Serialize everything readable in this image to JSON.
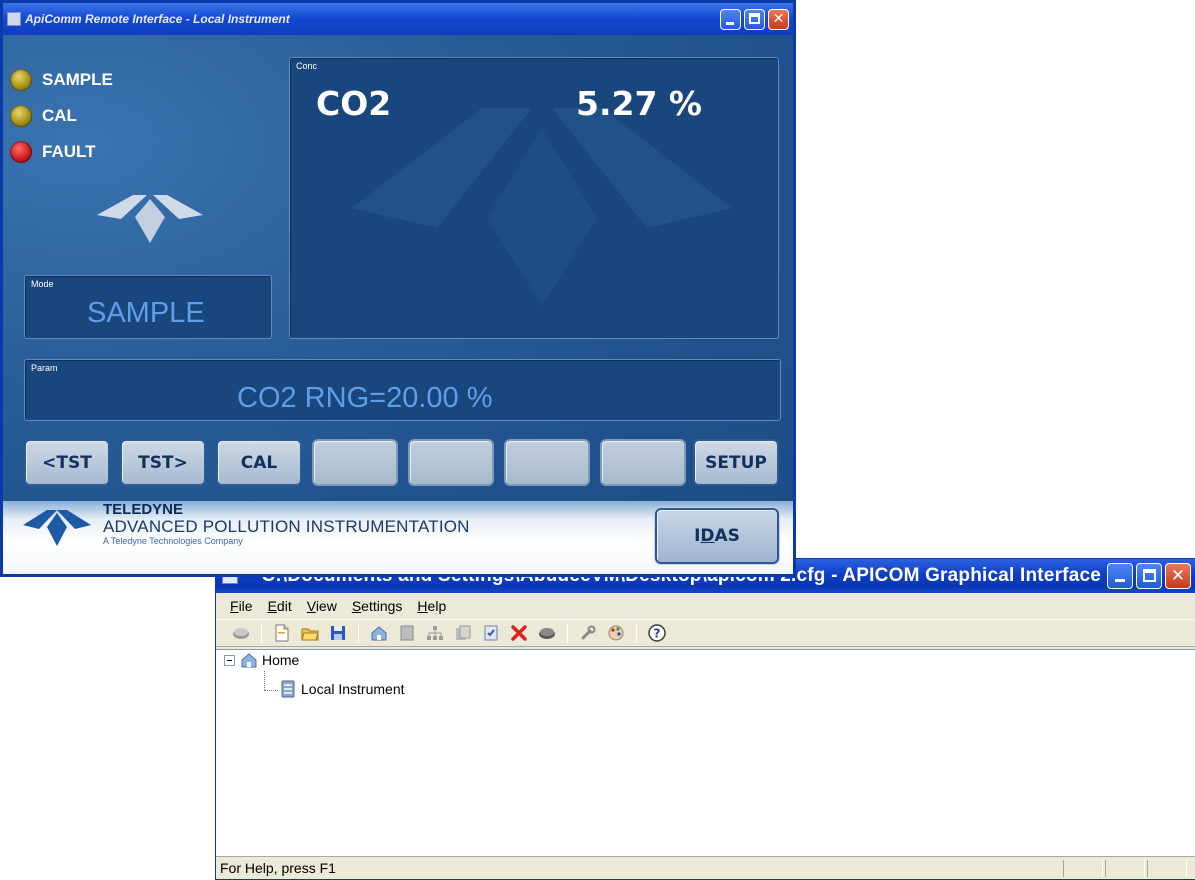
{
  "remote_window": {
    "title": "ApiComm Remote Interface - Local Instrument",
    "status_leds": [
      {
        "label": "SAMPLE",
        "color": "#c8b22a"
      },
      {
        "label": "CAL",
        "color": "#c8b22a"
      },
      {
        "label": "FAULT",
        "color": "#d02020"
      }
    ],
    "conc_panel": {
      "label": "Conc",
      "gas": "CO2",
      "value": "5.27 %"
    },
    "mode_panel": {
      "label": "Mode",
      "value": "SAMPLE"
    },
    "param_panel": {
      "label": "Param",
      "value": "CO2 RNG=20.00 %"
    },
    "keys": [
      "<TST",
      "TST>",
      "CAL",
      "",
      "",
      "",
      "",
      "SETUP"
    ],
    "brand": {
      "name": "TELEDYNE",
      "subtitle": "ADVANCED POLLUTION INSTRUMENTATION",
      "tagline": "A Teledyne Technologies Company"
    },
    "idas_button": {
      "prefix": "I",
      "underlined": "D",
      "suffix": "AS"
    }
  },
  "apicom_window": {
    "title": "C:\\Documents and Settings\\AbudeeVM\\Desktop\\apicom 2.cfg - APICOM Graphical Interface",
    "menu": [
      "File",
      "Edit",
      "View",
      "Settings",
      "Help"
    ],
    "toolbar_icons": [
      "connect-icon",
      "new-file-icon",
      "open-folder-icon",
      "save-disk-icon",
      "home-icon",
      "instrument-icon",
      "network-icon",
      "copy-icon",
      "properties-icon",
      "delete-icon",
      "disconnect-icon",
      "wrench-icon",
      "palette-icon",
      "help-icon"
    ],
    "tree": {
      "root": "Home",
      "child": "Local Instrument"
    },
    "status_text": "For Help, press F1"
  },
  "colors": {
    "panel_bg": "#19467d",
    "value_text": "#5f9ee8",
    "xp_title": "#0f3fc6"
  }
}
